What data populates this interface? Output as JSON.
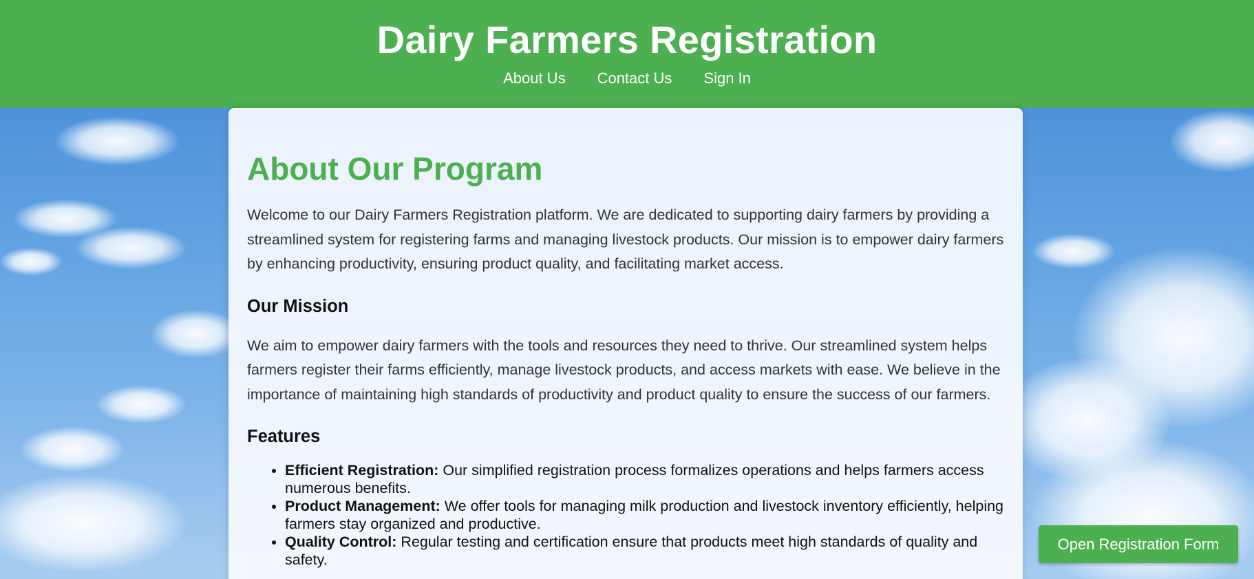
{
  "header": {
    "title": "Dairy Farmers Registration",
    "nav": [
      "About Us",
      "Contact Us",
      "Sign In"
    ]
  },
  "main": {
    "heading": "About Our Program",
    "intro": "Welcome to our Dairy Farmers Registration platform. We are dedicated to supporting dairy farmers by providing a streamlined system for registering farms and managing livestock products. Our mission is to empower dairy farmers by enhancing productivity, ensuring product quality, and facilitating market access.",
    "mission_heading": "Our Mission",
    "mission_text": "We aim to empower dairy farmers with the tools and resources they need to thrive. Our streamlined system helps farmers register their farms efficiently, manage livestock products, and access markets with ease. We believe in the importance of maintaining high standards of productivity and product quality to ensure the success of our farmers.",
    "features_heading": "Features",
    "features": [
      {
        "title": "Efficient Registration:",
        "text": " Our simplified registration process formalizes operations and helps farmers access numerous benefits."
      },
      {
        "title": "Product Management:",
        "text": " We offer tools for managing milk production and livestock inventory efficiently, helping farmers stay organized and productive."
      },
      {
        "title": "Quality Control:",
        "text": " Regular testing and certification ensure that products meet high standards of quality and safety."
      }
    ]
  },
  "open_form_button": "Open Registration Form",
  "colors": {
    "brand_green": "#4caf50",
    "sky_blue": "#4a90d9"
  }
}
